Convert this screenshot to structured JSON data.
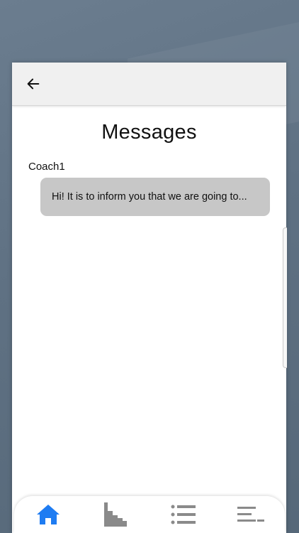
{
  "header": {
    "back_icon": "arrow-left-icon"
  },
  "page": {
    "title": "Messages"
  },
  "messages": [
    {
      "sender": "Coach1",
      "preview": "Hi! It is to inform you that we are going to..."
    }
  ],
  "tabbar": {
    "tabs": [
      {
        "icon": "home-icon",
        "active": true,
        "color": "#1e7cf2"
      },
      {
        "icon": "stats-icon",
        "active": false,
        "color": "#8a8a8a"
      },
      {
        "icon": "list-icon",
        "active": false,
        "color": "#8a8a8a"
      },
      {
        "icon": "menu-lines-icon",
        "active": false,
        "color": "#8a8a8a"
      }
    ]
  },
  "colors": {
    "bubble": "#c7c7c7",
    "active_tab": "#1e7cf2",
    "inactive_tab": "#8a8a8a"
  }
}
